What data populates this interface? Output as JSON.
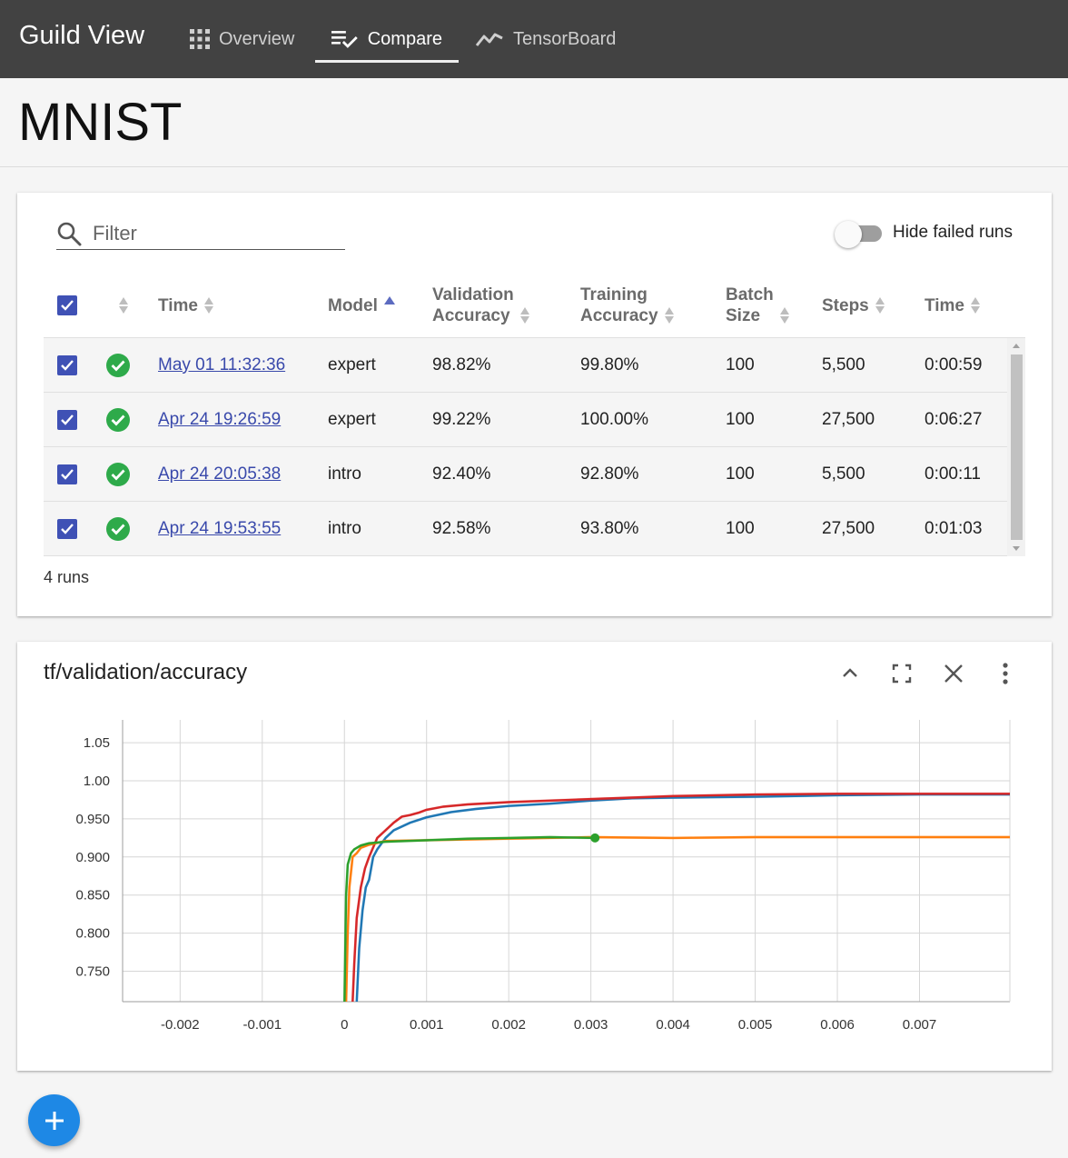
{
  "app": {
    "title": "Guild View"
  },
  "nav": {
    "tabs": [
      {
        "label": "Overview",
        "icon": "grid-icon",
        "active": false
      },
      {
        "label": "Compare",
        "icon": "compare-check-icon",
        "active": true
      },
      {
        "label": "TensorBoard",
        "icon": "line-chart-icon",
        "active": false
      }
    ]
  },
  "page": {
    "title": "MNIST"
  },
  "filter": {
    "placeholder": "Filter",
    "value": ""
  },
  "hide_failed": {
    "label": "Hide failed runs",
    "on": false
  },
  "table": {
    "headers": {
      "time": "Time",
      "model": "Model",
      "val_acc_1": "Validation",
      "val_acc_2": "Accuracy",
      "train_acc_1": "Training",
      "train_acc_2": "Accuracy",
      "batch_1": "Batch",
      "batch_2": "Size",
      "steps": "Steps",
      "duration": "Time"
    },
    "rows": [
      {
        "checked": true,
        "status": "completed",
        "time": "May 01 11:32:36",
        "model": "expert",
        "val_acc": "98.82%",
        "train_acc": "99.80%",
        "batch": "100",
        "steps": "5,500",
        "duration": "0:00:59"
      },
      {
        "checked": true,
        "status": "completed",
        "time": "Apr 24 19:26:59",
        "model": "expert",
        "val_acc": "99.22%",
        "train_acc": "100.00%",
        "batch": "100",
        "steps": "27,500",
        "duration": "0:06:27"
      },
      {
        "checked": true,
        "status": "completed",
        "time": "Apr 24 20:05:38",
        "model": "intro",
        "val_acc": "92.40%",
        "train_acc": "92.80%",
        "batch": "100",
        "steps": "5,500",
        "duration": "0:00:11"
      },
      {
        "checked": true,
        "status": "completed",
        "time": "Apr 24 19:53:55",
        "model": "intro",
        "val_acc": "92.58%",
        "train_acc": "93.80%",
        "batch": "100",
        "steps": "27,500",
        "duration": "0:01:03"
      }
    ],
    "count_label": "4 runs"
  },
  "colors": {
    "checkbox": "#3f51b5",
    "status_ok": "#2eaa4a",
    "link": "#3949ab",
    "fab": "#1e88e5"
  },
  "chart_data": {
    "type": "line",
    "title": "tf/validation/accuracy",
    "xlabel": "",
    "ylabel": "",
    "xlim": [
      -0.0027,
      0.0081
    ],
    "ylim": [
      0.71,
      1.08
    ],
    "x_ticks": [
      "-0.002",
      "-0.001",
      "0",
      "0.001",
      "0.002",
      "0.003",
      "0.004",
      "0.005",
      "0.006",
      "0.007"
    ],
    "x_tick_values": [
      -0.002,
      -0.001,
      0,
      0.001,
      0.002,
      0.003,
      0.004,
      0.005,
      0.006,
      0.007
    ],
    "y_ticks": [
      "0.750",
      "0.800",
      "0.850",
      "0.900",
      "0.950",
      "1.00",
      "1.05"
    ],
    "y_tick_values": [
      0.75,
      0.8,
      0.85,
      0.9,
      0.95,
      1.0,
      1.05
    ],
    "grid": true,
    "series": [
      {
        "color": "#1f77b4",
        "x": [
          0.00015,
          0.00018,
          0.00022,
          0.00026,
          0.0003,
          0.00035,
          0.0004,
          0.0005,
          0.0006,
          0.0008,
          0.001,
          0.0013,
          0.0016,
          0.002,
          0.0025,
          0.003,
          0.0035,
          0.004,
          0.005,
          0.006,
          0.007,
          0.0081
        ],
        "y": [
          0.71,
          0.78,
          0.83,
          0.86,
          0.87,
          0.9,
          0.91,
          0.925,
          0.935,
          0.945,
          0.952,
          0.959,
          0.963,
          0.967,
          0.97,
          0.974,
          0.977,
          0.978,
          0.979,
          0.981,
          0.982,
          0.982
        ]
      },
      {
        "color": "#d62728",
        "x": [
          0.0001,
          0.00012,
          0.00015,
          0.0002,
          0.00025,
          0.0003,
          0.0004,
          0.0005,
          0.0006,
          0.0007,
          0.0008,
          0.0009,
          0.001,
          0.0012,
          0.0015,
          0.002,
          0.0025,
          0.003,
          0.0035,
          0.004,
          0.005,
          0.006,
          0.007,
          0.0081
        ],
        "y": [
          0.71,
          0.76,
          0.82,
          0.86,
          0.885,
          0.9,
          0.925,
          0.935,
          0.945,
          0.953,
          0.955,
          0.958,
          0.962,
          0.966,
          0.969,
          0.972,
          0.974,
          0.976,
          0.978,
          0.98,
          0.982,
          0.983,
          0.983,
          0.983
        ]
      },
      {
        "color": "#ff7f0e",
        "x": [
          2e-05,
          4e-05,
          6e-05,
          0.0001,
          0.00015,
          0.0002,
          0.0003,
          0.0005,
          0.001,
          0.002,
          0.003,
          0.004,
          0.005,
          0.006,
          0.007,
          0.0081
        ],
        "y": [
          0.71,
          0.8,
          0.86,
          0.9,
          0.905,
          0.912,
          0.916,
          0.921,
          0.922,
          0.924,
          0.926,
          0.925,
          0.926,
          0.926,
          0.926,
          0.926
        ]
      },
      {
        "color": "#2ca02c",
        "x": [
          0.0,
          2e-05,
          4e-05,
          8e-05,
          0.00012,
          0.0002,
          0.0003,
          0.0005,
          0.001,
          0.0015,
          0.002,
          0.0025,
          0.00305
        ],
        "y": [
          0.71,
          0.85,
          0.89,
          0.905,
          0.91,
          0.915,
          0.918,
          0.92,
          0.922,
          0.924,
          0.925,
          0.926,
          0.925
        ]
      }
    ]
  }
}
